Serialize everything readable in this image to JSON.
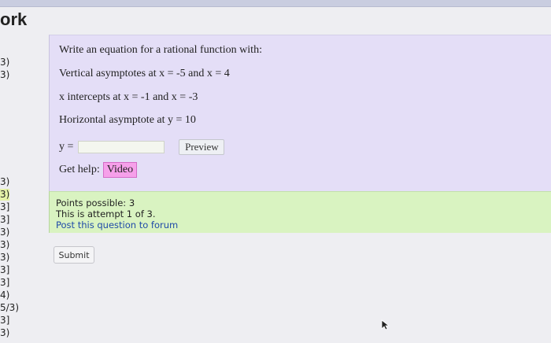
{
  "header": {
    "title": "ork"
  },
  "scores": [
    "3)",
    "3)",
    "3)",
    "3)",
    "3]",
    "3]",
    "3)",
    "3)",
    "3)",
    "3]",
    "3]",
    "4)",
    "5/3)",
    "3]",
    "3)"
  ],
  "question": {
    "prompt": "Write an equation for a rational function with:",
    "vertical": "Vertical asymptotes at x = -5 and x = 4",
    "intercepts": "x intercepts at x = -1 and x = -3",
    "horizontal": "Horizontal asymptote at y = 10",
    "answer_label": "y =",
    "answer_value": "",
    "preview_label": "Preview",
    "help_label": "Get help:",
    "video_label": "Video"
  },
  "info": {
    "points": "Points possible: 3",
    "attempt": "This is attempt 1 of 3.",
    "forum_link": "Post this question to forum"
  },
  "submit_label": "Submit",
  "colors": {
    "question_bg": "#e4def7",
    "info_bg": "#d9f3c1",
    "video_bg": "#f6a0ea",
    "link": "#1f4aa8"
  }
}
